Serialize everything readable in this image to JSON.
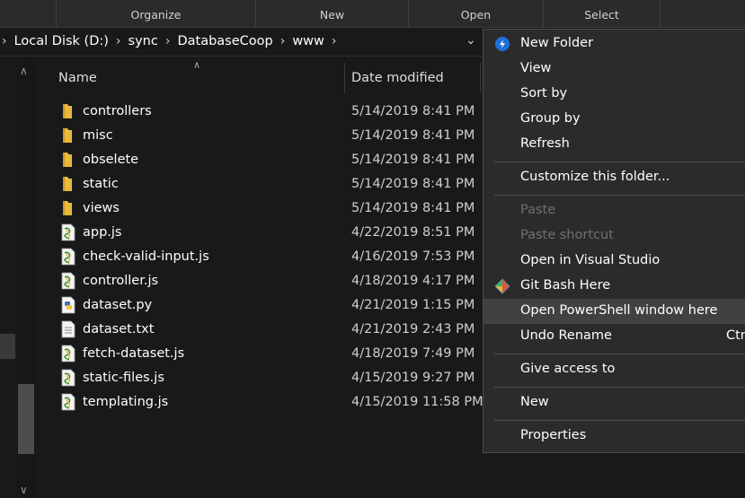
{
  "ribbon": {
    "groups": [
      "Organize",
      "New",
      "Open",
      "Select"
    ]
  },
  "address": {
    "crumbs": [
      "Local Disk (D:)",
      "sync",
      "DatabaseCoop",
      "www"
    ]
  },
  "columns": {
    "name": "Name",
    "date": "Date modified"
  },
  "files": [
    {
      "name": "controllers",
      "date": "5/14/2019 8:41 PM",
      "icon": "folder-icon"
    },
    {
      "name": "misc",
      "date": "5/14/2019 8:41 PM",
      "icon": "folder-icon"
    },
    {
      "name": "obselete",
      "date": "5/14/2019 8:41 PM",
      "icon": "folder-icon"
    },
    {
      "name": "static",
      "date": "5/14/2019 8:41 PM",
      "icon": "folder-icon"
    },
    {
      "name": "views",
      "date": "5/14/2019 8:41 PM",
      "icon": "folder-icon"
    },
    {
      "name": "app.js",
      "date": "4/22/2019 8:51 PM",
      "icon": "js-file-icon"
    },
    {
      "name": "check-valid-input.js",
      "date": "4/16/2019 7:53 PM",
      "icon": "js-file-icon"
    },
    {
      "name": "controller.js",
      "date": "4/18/2019 4:17 PM",
      "icon": "js-file-icon"
    },
    {
      "name": "dataset.py",
      "date": "4/21/2019 1:15 PM",
      "icon": "python-file-icon"
    },
    {
      "name": "dataset.txt",
      "date": "4/21/2019 2:43 PM",
      "icon": "text-file-icon"
    },
    {
      "name": "fetch-dataset.js",
      "date": "4/18/2019 7:49 PM",
      "icon": "js-file-icon"
    },
    {
      "name": "static-files.js",
      "date": "4/15/2019 9:27 PM",
      "icon": "js-file-icon"
    },
    {
      "name": "templating.js",
      "date": "4/15/2019 11:58 PM",
      "icon": "js-file-icon"
    }
  ],
  "context_menu": {
    "items": [
      {
        "label": "New Folder",
        "icon": "new-folder-icon"
      },
      {
        "label": "View"
      },
      {
        "label": "Sort by"
      },
      {
        "label": "Group by"
      },
      {
        "label": "Refresh"
      },
      {
        "label": "Customize this folder..."
      },
      {
        "label": "Paste",
        "disabled": true
      },
      {
        "label": "Paste shortcut",
        "disabled": true
      },
      {
        "label": "Open in Visual Studio"
      },
      {
        "label": "Git Bash Here",
        "icon": "git-icon"
      },
      {
        "label": "Open PowerShell window here",
        "highlighted": true
      },
      {
        "label": "Undo Rename",
        "accel": "Ctr"
      },
      {
        "label": "Give access to"
      },
      {
        "label": "New"
      },
      {
        "label": "Properties"
      }
    ]
  },
  "colors": {
    "background": "#191919",
    "menu_bg": "#2b2b2b",
    "folder": "#e8b93a",
    "highlight": "#414141"
  }
}
